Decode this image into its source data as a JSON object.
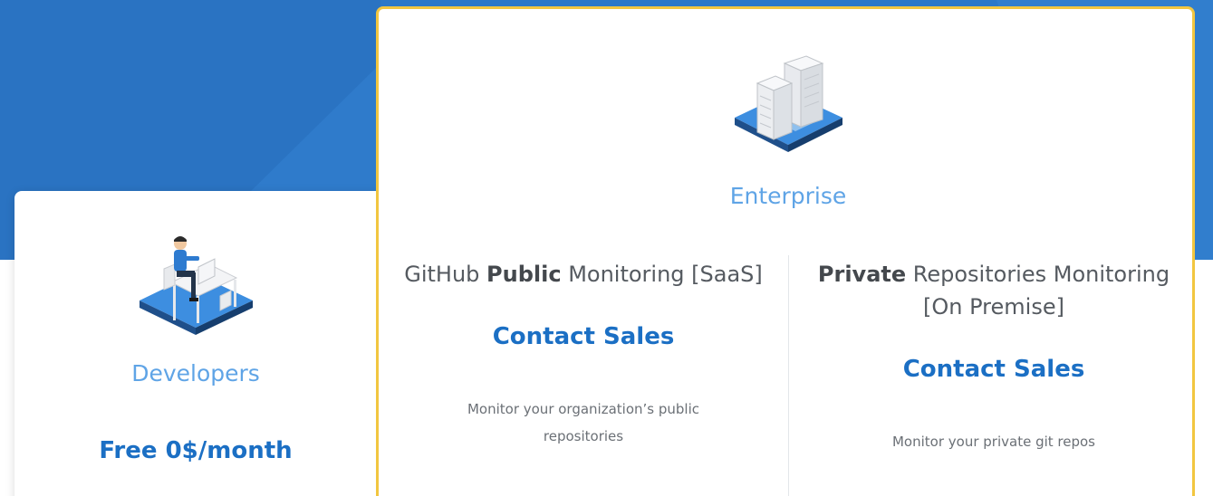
{
  "developers": {
    "tier_label": "Developers",
    "price": "Free 0$/month",
    "illustration_icon": "developer-at-desk-icon"
  },
  "enterprise": {
    "tier_label": "Enterprise",
    "illustration_icon": "office-buildings-icon",
    "plans": [
      {
        "title_pre": "GitHub ",
        "title_bold": "Public",
        "title_post": " Monitoring [SaaS]",
        "cta": "Contact Sales",
        "description": "Monitor your organization’s public repositories"
      },
      {
        "title_pre": "",
        "title_bold": "Private",
        "title_post": " Repositories Monitoring [On Premise]",
        "cta": "Contact Sales",
        "description": "Monitor your private git repos"
      }
    ]
  },
  "colors": {
    "hero_blue": "#2c78c8",
    "accent_blue": "#1b6fc4",
    "tier_blue": "#5fa4e6",
    "highlight_border": "#f2c640"
  }
}
